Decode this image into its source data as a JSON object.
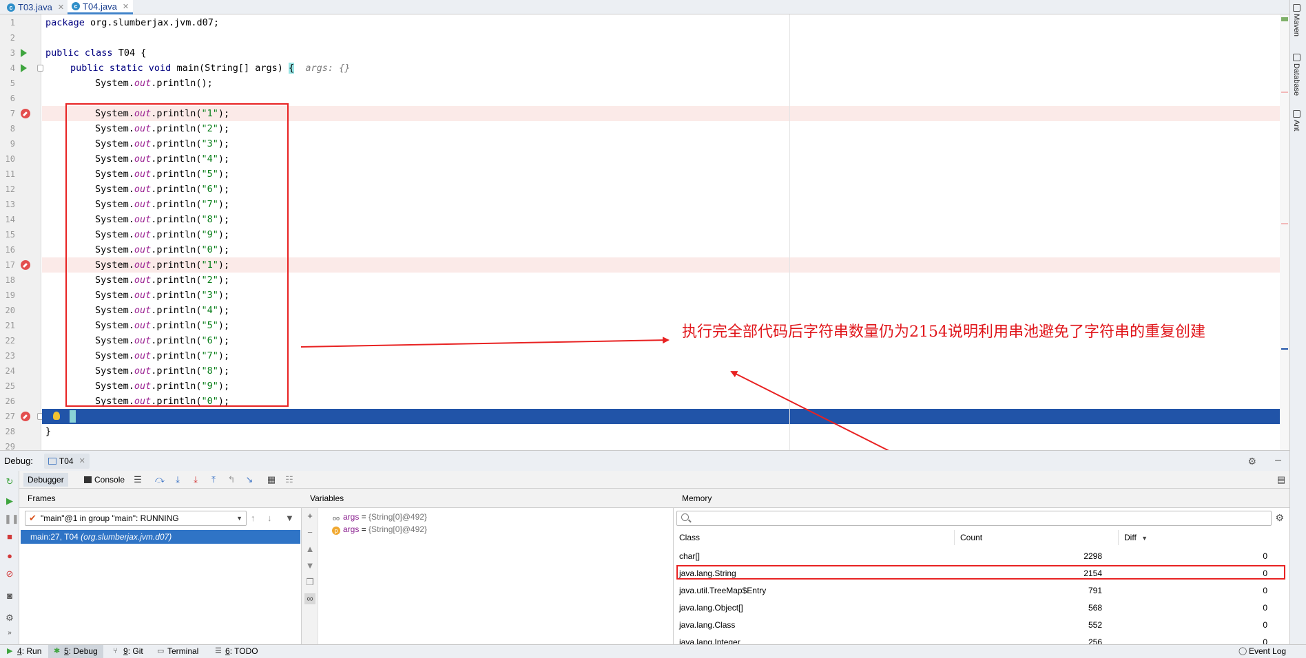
{
  "tabs": [
    {
      "label": "T03.java",
      "icon": "c"
    },
    {
      "label": "T04.java",
      "icon": "c"
    }
  ],
  "right_tools": [
    "Maven",
    "Database",
    "Ant"
  ],
  "editor": {
    "line_numbers": [
      "1",
      "2",
      "3",
      "4",
      "5",
      "6",
      "7",
      "8",
      "9",
      "10",
      "11",
      "12",
      "13",
      "14",
      "15",
      "16",
      "17",
      "18",
      "19",
      "20",
      "21",
      "22",
      "23",
      "24",
      "25",
      "26",
      "27",
      "28",
      "29"
    ],
    "package_kw": "package",
    "package_name": " org.slumberjax.jvm.d07;",
    "class_kw1": "public",
    "class_kw2": "class",
    "class_name": " T04 {",
    "main_kw": "public static void",
    "main_sig": " main(String[] args) ",
    "main_brace": "{",
    "main_hint": "args: {}",
    "sys_prefix": "System.",
    "out": "out",
    "println_empty": ".println();",
    "println_open": ".println(",
    "println_close": ");",
    "string_values": [
      "\"1\"",
      "\"2\"",
      "\"3\"",
      "\"4\"",
      "\"5\"",
      "\"6\"",
      "\"7\"",
      "\"8\"",
      "\"9\"",
      "\"0\"",
      "\"1\"",
      "\"2\"",
      "\"3\"",
      "\"4\"",
      "\"5\"",
      "\"6\"",
      "\"7\"",
      "\"8\"",
      "\"9\"",
      "\"0\""
    ],
    "class_close": "}"
  },
  "annotation": {
    "text": "执行完全部代码后字符串数量仍为2154说明利用串池避免了字符串的重复创建",
    "color": "#e0161b"
  },
  "debug": {
    "label": "Debug:",
    "session_tab": "T04",
    "tabs": [
      "Debugger",
      "Console"
    ],
    "frames_title": "Frames",
    "thread": "\"main\"@1 in group \"main\": RUNNING",
    "frame_method": "main:27, T04",
    "frame_location": "(org.slumberjax.jvm.d07)",
    "variables_title": "Variables",
    "variables": [
      {
        "icon": "oo",
        "name": "args",
        "eq": " = ",
        "value": "{String[0]@492}"
      },
      {
        "icon": "p",
        "name": "args",
        "eq": " = ",
        "value": "{String[0]@492}"
      }
    ],
    "memory_title": "Memory",
    "memory_search_placeholder": "",
    "memory_columns": [
      "Class",
      "Count",
      "Diff"
    ],
    "memory_rows": [
      {
        "class": "char[]",
        "count": "2298",
        "diff": "0"
      },
      {
        "class": "java.lang.String",
        "count": "2154",
        "diff": "0"
      },
      {
        "class": "java.util.TreeMap$Entry",
        "count": "791",
        "diff": "0"
      },
      {
        "class": "java.lang.Object[]",
        "count": "568",
        "diff": "0"
      },
      {
        "class": "java.lang.Class",
        "count": "552",
        "diff": "0"
      },
      {
        "class": "java.lang.Integer",
        "count": "256",
        "diff": "0"
      }
    ]
  },
  "statusbar": {
    "items": [
      {
        "num": "4",
        "label": ": Run"
      },
      {
        "num": "5",
        "label": ": Debug"
      },
      {
        "num": "9",
        "label": ": Git"
      },
      {
        "num": "",
        "label": "Terminal"
      },
      {
        "num": "6",
        "label": ": TODO"
      }
    ],
    "event_log": "Event Log"
  },
  "colors": {
    "keyword": "#000080",
    "field": "#9b2393",
    "string": "#067d17",
    "selection": "#2f74c6",
    "exec_line": "#2154a8",
    "breakpoint_line": "#fbeae8",
    "annotation_red": "#e82222"
  }
}
